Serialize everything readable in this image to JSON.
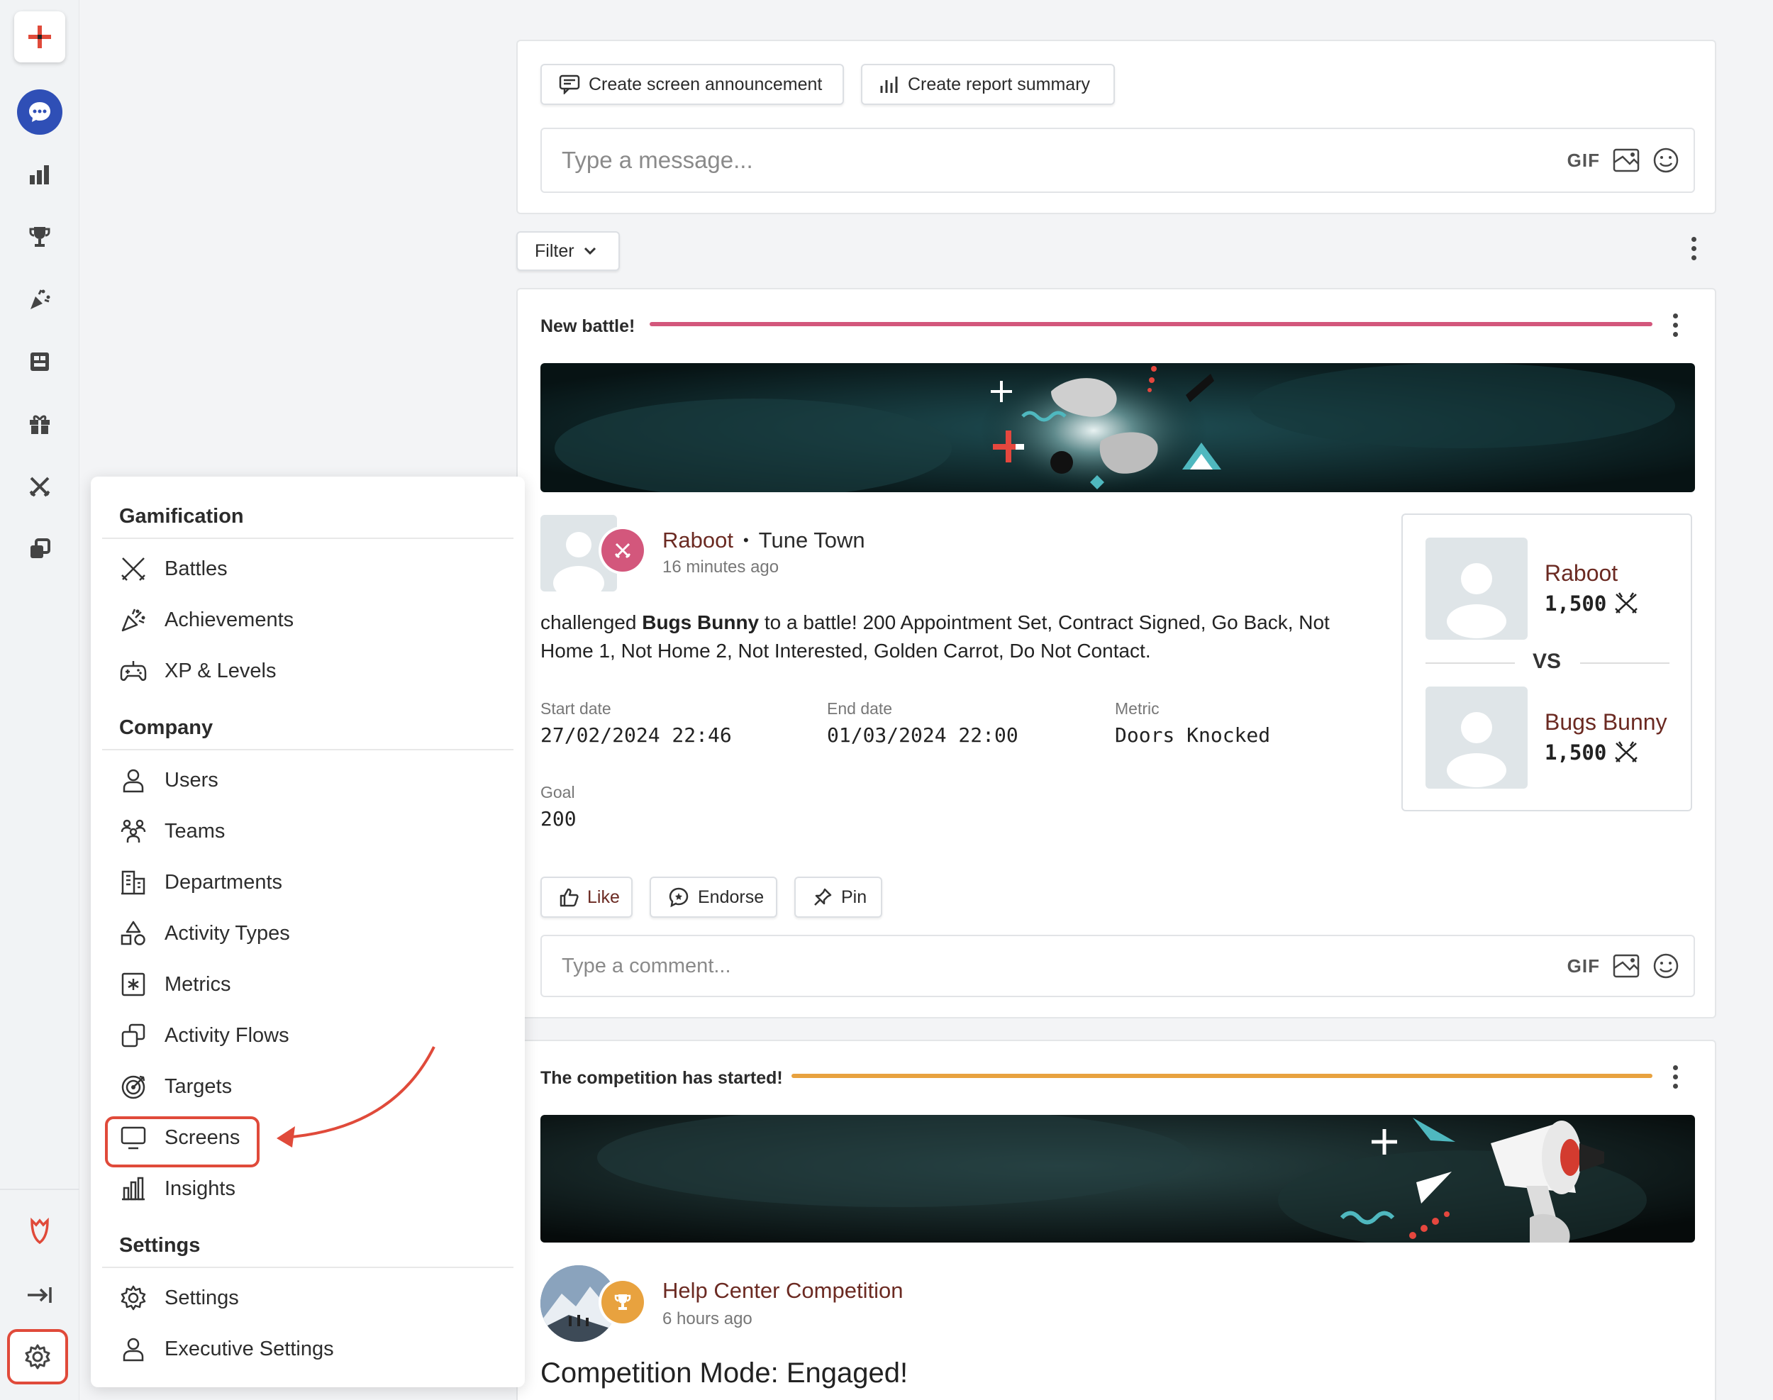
{
  "colors": {
    "accent_red": "#e04a3a",
    "battle_bar": "#d3577c",
    "competition_bar": "#e8a23f",
    "name_link": "#6b2a22",
    "chat_blue": "#2f4fb6"
  },
  "rail": {
    "icons": [
      "plus-icon",
      "chat-icon",
      "bar-chart-icon",
      "trophy-icon",
      "party-popper-icon",
      "leaderboard-icon",
      "gift-icon",
      "battle-swords-icon",
      "activity-flows-icon",
      "brand-logo-icon",
      "collapse-icon",
      "gear-icon"
    ]
  },
  "menu": {
    "gamification": {
      "title": "Gamification",
      "items": [
        {
          "label": "Battles",
          "icon": "battle-swords-icon"
        },
        {
          "label": "Achievements",
          "icon": "party-popper-icon"
        },
        {
          "label": "XP & Levels",
          "icon": "gamepad-icon"
        }
      ]
    },
    "company": {
      "title": "Company",
      "items": [
        {
          "label": "Users",
          "icon": "user-icon"
        },
        {
          "label": "Teams",
          "icon": "team-icon"
        },
        {
          "label": "Departments",
          "icon": "building-icon"
        },
        {
          "label": "Activity Types",
          "icon": "shapes-icon"
        },
        {
          "label": "Metrics",
          "icon": "metrics-icon"
        },
        {
          "label": "Activity Flows",
          "icon": "activity-flows-icon"
        },
        {
          "label": "Targets",
          "icon": "target-icon"
        },
        {
          "label": "Screens",
          "icon": "monitor-icon"
        },
        {
          "label": "Insights",
          "icon": "insights-icon"
        }
      ]
    },
    "settings": {
      "title": "Settings",
      "items": [
        {
          "label": "Settings",
          "icon": "gear-icon"
        },
        {
          "label": "Executive Settings",
          "icon": "user-icon"
        }
      ]
    }
  },
  "composer": {
    "announce_label": "Create screen announcement",
    "report_label": "Create report summary",
    "message_placeholder": "Type a message...",
    "gif_label": "GIF"
  },
  "feed": {
    "filter_label": "Filter"
  },
  "battle_post": {
    "title": "New battle!",
    "author": "Raboot",
    "separator": "•",
    "team": "Tune Town",
    "time": "16 minutes ago",
    "text_prefix": "challenged ",
    "text_bold": "Bugs Bunny",
    "text_suffix": " to a battle! 200 Appointment Set, Contract Signed, Go Back, Not Home 1, Not Home 2, Not Interested, Golden Carrot, Do Not Contact.",
    "start_label": "Start date",
    "start_value": "27/02/2024 22:46",
    "end_label": "End date",
    "end_value": "01/03/2024 22:00",
    "metric_label": "Metric",
    "metric_value": "Doors Knocked",
    "goal_label": "Goal",
    "goal_value": "200",
    "like_label": "Like",
    "endorse_label": "Endorse",
    "pin_label": "Pin",
    "comment_placeholder": "Type a comment...",
    "gif_label": "GIF",
    "versus": {
      "player1_name": "Raboot",
      "player1_score": "1,500",
      "vs_label": "VS",
      "player2_name": "Bugs Bunny",
      "player2_score": "1,500"
    }
  },
  "competition_post": {
    "title": "The competition has started!",
    "author": "Help Center Competition",
    "time": "6 hours ago",
    "heading": "Competition Mode: Engaged!"
  }
}
